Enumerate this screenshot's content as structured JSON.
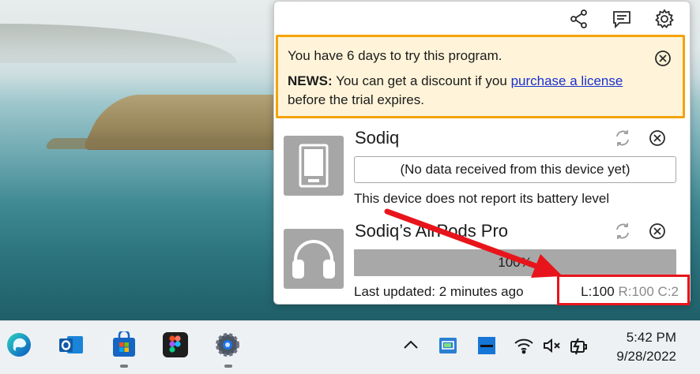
{
  "panel": {
    "trial_notice": {
      "line1": "You have 6 days to try this program.",
      "news_label": "NEWS:",
      "news_text": "You can get a discount if you",
      "link_text": "purchase a license",
      "line2_tail": "before the trial expires."
    },
    "devices": [
      {
        "name": "Sodiq",
        "status": "(No data received from this device yet)",
        "footer": "This device does not report its battery level"
      },
      {
        "name": "Sodiq’s AirPods Pro",
        "bar_label": "100%",
        "battery_level": 100,
        "footer": "Last updated: 2 minutes ago",
        "levels_left": "L:100",
        "levels_rest": "R:100 C:2"
      }
    ]
  },
  "taskbar": {
    "time": "5:42 PM",
    "date": "9/28/2022"
  },
  "colors": {
    "notice_border": "#f5a20a",
    "notice_bg": "#fff4d9",
    "annotation_red": "#e8141b",
    "link": "#1a2fd1"
  }
}
